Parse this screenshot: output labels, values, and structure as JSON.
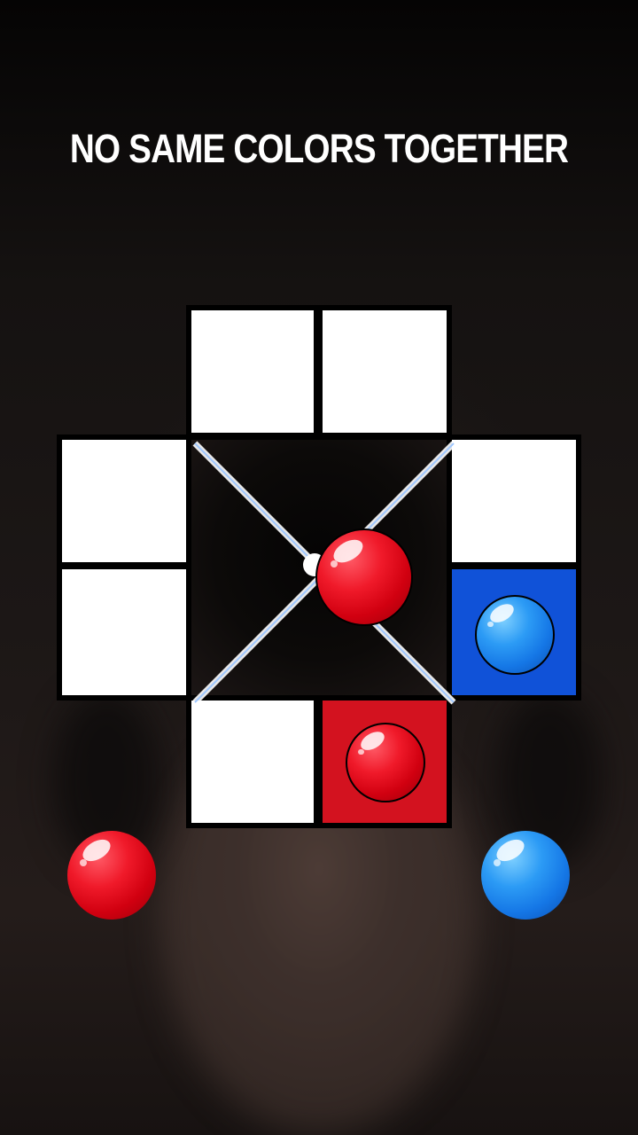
{
  "title": "NO SAME COLORS TOGETHER",
  "colors": {
    "red": "#d3121f",
    "blue": "#1052d8",
    "empty": "#ffffff",
    "grid_line": "#000000",
    "spinner_line": "#dfefff"
  },
  "board": {
    "cells": [
      {
        "name": "top-left",
        "state": "empty"
      },
      {
        "name": "top-right",
        "state": "empty"
      },
      {
        "name": "left-top",
        "state": "empty"
      },
      {
        "name": "left-bottom",
        "state": "empty"
      },
      {
        "name": "right-top",
        "state": "empty"
      },
      {
        "name": "right-bottom",
        "state": "blue"
      },
      {
        "name": "bottom-left",
        "state": "empty"
      },
      {
        "name": "bottom-right",
        "state": "red"
      }
    ]
  },
  "spinner": {
    "ball": "red"
  },
  "player_balls": {
    "left": "red",
    "right": "blue"
  }
}
